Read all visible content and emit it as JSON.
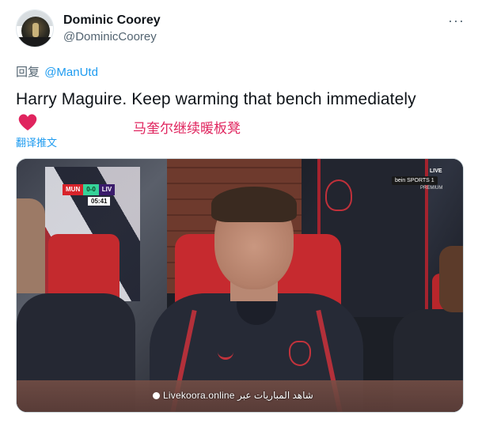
{
  "author": {
    "name": "Dominic Coorey",
    "handle": "@DominicCoorey"
  },
  "more_icon": "more-horizontal-icon",
  "reply": {
    "prefix": "回复",
    "to": "@ManUtd"
  },
  "tweet_text": "Harry Maguire. Keep warming that bench immediately",
  "heart_color": "#e0245e",
  "annotation": "马奎尔继续暖板凳",
  "translate_label": "翻译推文",
  "media": {
    "scorebug": {
      "home": "MUN",
      "score": "0-0",
      "away": "LIV",
      "clock": "05:41"
    },
    "channel": "bein SPORTS 1",
    "channel_live": "LIVE",
    "channel_sub": "PREMIUM",
    "watermark": "Livekoora.online شاهد المباريات عبر"
  },
  "colors": {
    "link": "#1d9bf0",
    "text": "#0f1419",
    "secondary": "#536471",
    "annotation": "#e0245e"
  }
}
